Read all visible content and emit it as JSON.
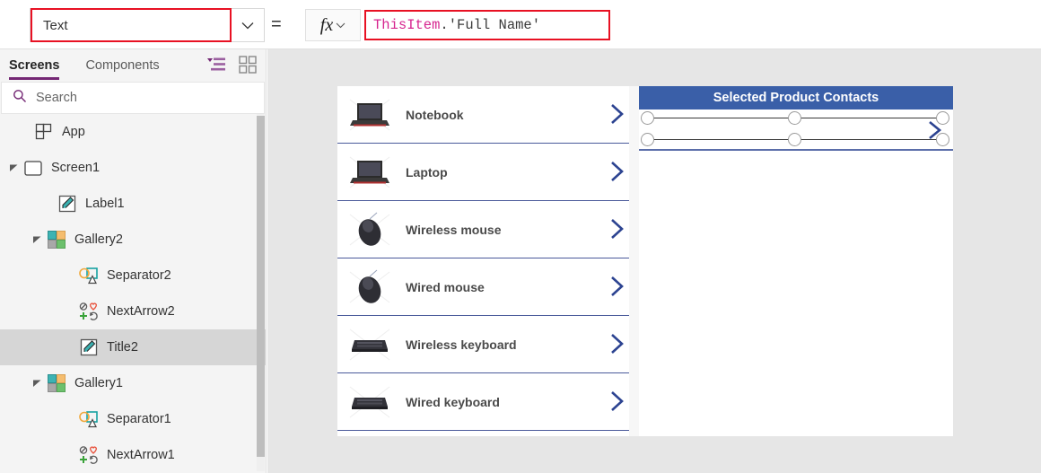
{
  "formula_bar": {
    "property_value": "Text",
    "property_chevron_icon": "chevron-down-icon",
    "equals_sign": "=",
    "fx_label": "fx",
    "fx_chevron_icon": "chevron-down-icon",
    "formula_tokens": [
      {
        "text": "ThisItem",
        "kind": "identifier"
      },
      {
        "text": ".'Full Name'",
        "kind": "plain"
      }
    ],
    "accent_red": "#e81123"
  },
  "tree_panel": {
    "tabs": [
      {
        "label": "Screens",
        "active": true
      },
      {
        "label": "Components",
        "active": false
      }
    ],
    "tools": [
      {
        "name": "list-view-icon",
        "active": true
      },
      {
        "name": "grid-view-icon",
        "active": false
      }
    ],
    "search": {
      "placeholder": "Search",
      "value": "Search",
      "icon": "search-icon"
    },
    "accent_purple": "#742774",
    "items": [
      {
        "label": "App",
        "icon": "app-icon",
        "indent": 22,
        "expander": "none",
        "selected": false
      },
      {
        "label": "Screen1",
        "icon": "screen-icon",
        "indent": 10,
        "expander": "expanded",
        "selected": false
      },
      {
        "label": "Label1",
        "icon": "label-icon",
        "indent": 48,
        "expander": "none",
        "selected": false
      },
      {
        "label": "Gallery2",
        "icon": "gallery-icon",
        "indent": 36,
        "expander": "expanded",
        "selected": false
      },
      {
        "label": "Separator2",
        "icon": "shapes-icon",
        "indent": 72,
        "expander": "none",
        "selected": false
      },
      {
        "label": "NextArrow2",
        "icon": "icons-group-icon",
        "indent": 72,
        "expander": "none",
        "selected": false
      },
      {
        "label": "Title2",
        "icon": "label-icon",
        "indent": 72,
        "expander": "none",
        "selected": true
      },
      {
        "label": "Gallery1",
        "icon": "gallery-icon",
        "indent": 36,
        "expander": "expanded",
        "selected": false
      },
      {
        "label": "Separator1",
        "icon": "shapes-icon",
        "indent": 72,
        "expander": "none",
        "selected": false
      },
      {
        "label": "NextArrow1",
        "icon": "icons-group-icon",
        "indent": 72,
        "expander": "none",
        "selected": false
      }
    ]
  },
  "canvas": {
    "product_gallery": {
      "items": [
        {
          "label": "Notebook",
          "thumb": "laptop-open-image",
          "chevron_icon": "chevron-right-icon"
        },
        {
          "label": "Laptop",
          "thumb": "laptop-open-image",
          "chevron_icon": "chevron-right-icon"
        },
        {
          "label": "Wireless mouse",
          "thumb": "mouse-image",
          "chevron_icon": "chevron-right-icon"
        },
        {
          "label": "Wired mouse",
          "thumb": "mouse-image",
          "chevron_icon": "chevron-right-icon"
        },
        {
          "label": "Wireless keyboard",
          "thumb": "keyboard-image",
          "chevron_icon": "chevron-right-icon"
        },
        {
          "label": "Wired keyboard",
          "thumb": "keyboard-image",
          "chevron_icon": "chevron-right-icon"
        }
      ],
      "scrollbar": {
        "up_arrow_icon": "caret-up-icon",
        "down_arrow_icon": "caret-down-icon"
      }
    },
    "contacts_gallery": {
      "header_title": "Selected Product Contacts",
      "header_color": "#3a5fa8",
      "row_chevron_icon": "chevron-right-icon",
      "selection_handles": 6
    }
  }
}
